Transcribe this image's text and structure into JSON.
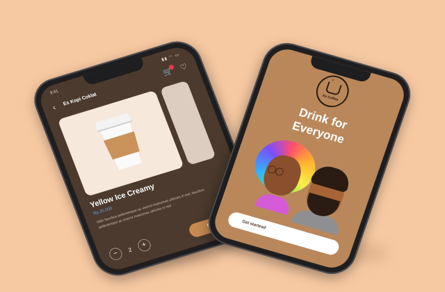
{
  "colors": {
    "background": "#f7c9a2",
    "left_screen": "#4b3a2d",
    "right_screen": "#b9875a",
    "accent": "#c98a52",
    "price": "#5fa8e8"
  },
  "left_phone": {
    "status_time": "9:41",
    "status_icons": "▮▮ ◠ ▭",
    "back_icon": "chevron-left-icon",
    "store_name": "Es Kopi Coklat",
    "cart_icon": "cart-icon",
    "heart_icon": "heart-icon",
    "product": {
      "title": "Yellow Ice Creamy",
      "price": "Rp.25.000",
      "description": "Nibh faucibus pellentesque ac viverra maecenas ultricies in nisl, faucibus pellentesque ac viverra maecenas ultricies in nisl"
    },
    "quantity": {
      "minus": "−",
      "value": "2",
      "plus": "+"
    },
    "continue_label": "Continue"
  },
  "right_phone": {
    "logo_brand": "Es Coffee",
    "logo_icon": "coffee-mug-icon",
    "headline_line1": "Drink for",
    "headline_line2": "Everyone",
    "cta_label": "Get startesd"
  }
}
